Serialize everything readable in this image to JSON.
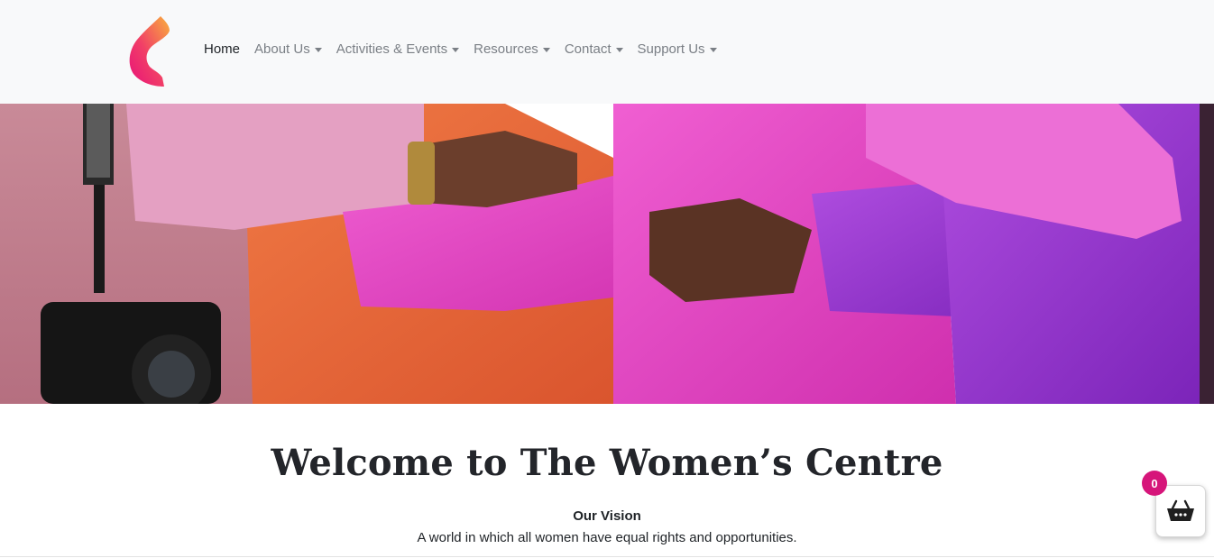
{
  "nav": {
    "items": [
      {
        "label": "Home",
        "active": true,
        "dropdown": false
      },
      {
        "label": "About Us",
        "active": false,
        "dropdown": true
      },
      {
        "label": "Activities & Events",
        "active": false,
        "dropdown": true
      },
      {
        "label": "Resources",
        "active": false,
        "dropdown": true
      },
      {
        "label": "Contact",
        "active": false,
        "dropdown": true
      },
      {
        "label": "Support Us",
        "active": false,
        "dropdown": true
      }
    ]
  },
  "hero": {
    "icon": "linked-arms-photo"
  },
  "main": {
    "title": "Welcome to The Women’s Centre",
    "vision_title": "Our Vision",
    "vision_text": "A world in which all women have equal rights and opportunities."
  },
  "cart": {
    "count": "0",
    "icon": "basket-icon"
  },
  "colors": {
    "navbar_bg": "#f8f9fa",
    "badge": "#d6157a",
    "logo_gradient": [
      "#f7a23b",
      "#ef2d6e",
      "#ea1577"
    ]
  }
}
